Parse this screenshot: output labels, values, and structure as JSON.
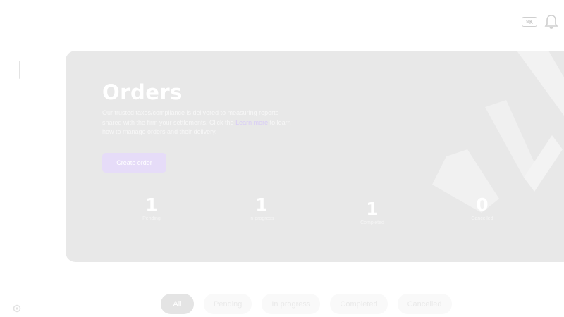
{
  "header": {
    "keyboard_icon_text": "⌘K"
  },
  "hero": {
    "title": "Orders",
    "description_part1": "Our trusted taxes/compliance is delivered to measuring reports shared with the firm your settlements. Click the",
    "description_link": "Learn more",
    "description_part2": "to learn how to manage orders and their delivery.",
    "cta_label": "Create order"
  },
  "stats": [
    {
      "value": "1",
      "label": "Pending"
    },
    {
      "value": "1",
      "label": "In progress"
    },
    {
      "value": "1",
      "label": "Completed"
    },
    {
      "value": "0",
      "label": "Cancelled"
    }
  ],
  "filters": {
    "tabs": [
      "All",
      "Pending",
      "In progress",
      "Completed",
      "Cancelled"
    ],
    "active_index": 0
  },
  "colors": {
    "hero_bg": "#e8e8e8",
    "accent": "#e6dcf8",
    "active_tab": "#e4e4e4"
  }
}
